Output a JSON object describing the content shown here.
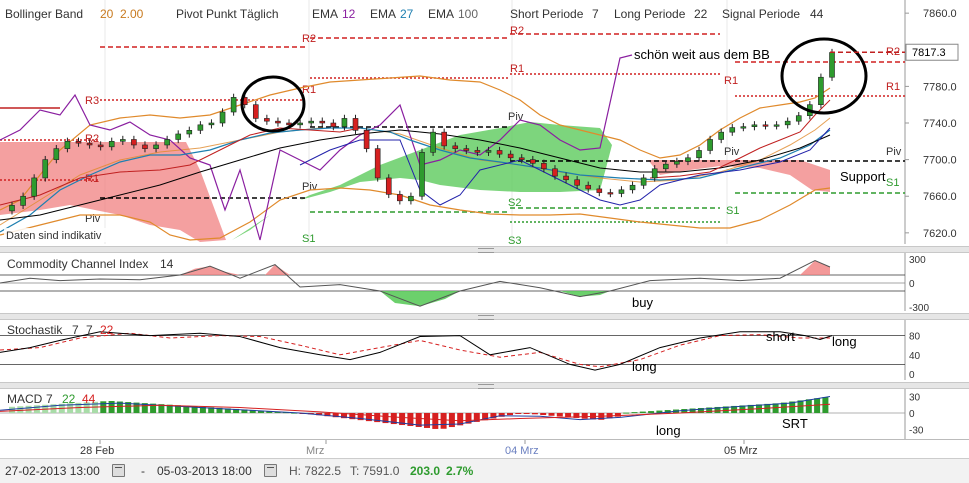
{
  "header": {
    "bollinger": {
      "label": "Bollinger Band",
      "p1": "20",
      "p2": "2.00"
    },
    "pivot": "Pivot Punkt Täglich",
    "ema1": {
      "label": "EMA",
      "value": "12"
    },
    "ema2": {
      "label": "EMA",
      "value": "27"
    },
    "ema3": {
      "label": "EMA",
      "value": "100"
    },
    "short": {
      "label": "Short Periode",
      "value": "7"
    },
    "long": {
      "label": "Long Periode",
      "value": "22"
    },
    "signal": {
      "label": "Signal Periode",
      "value": "44"
    }
  },
  "price_pane": {
    "axis_ticks": [
      "7860.0",
      "7820.0",
      "7780.0",
      "7740.0",
      "7700.0",
      "7660.0",
      "7620.0"
    ],
    "last_price": "7817.3",
    "disclaimer": "Daten sind indikativ",
    "annotations": {
      "bb_note": "schön weit aus dem BB",
      "support": "Support"
    },
    "pivot_labels": [
      "R2",
      "R1",
      "Piv",
      "S1",
      "S2",
      "S3"
    ]
  },
  "cci_pane": {
    "label": "Commodity Channel Index",
    "value": "14",
    "ticks": [
      "300",
      "0",
      "-300"
    ],
    "note": "buy"
  },
  "stoch_pane": {
    "label": "Stochastik",
    "p1": "7",
    "p2": "7",
    "p3": "22",
    "ticks": [
      "80",
      "40",
      "0"
    ],
    "notes": {
      "long1": "long",
      "short": "short",
      "long2": "long"
    }
  },
  "macd_pane": {
    "label": "MACD",
    "p1": "7",
    "p2": "22",
    "p3": "44",
    "ticks": [
      "30",
      "0",
      "-30"
    ],
    "notes": {
      "long": "long",
      "srt": "SRT"
    }
  },
  "x_axis": {
    "labels": [
      "28 Feb",
      "Mrz",
      "04 Mrz",
      "05 Mrz"
    ]
  },
  "footer": {
    "start": "27-02-2013 13:00",
    "dash": "-",
    "end": "05-03-2013 18:00",
    "high": "H: 7822.5",
    "low": "T: 7591.0",
    "change": "203.0",
    "pct": "2.7%"
  },
  "colors": {
    "up": "#2e9b2e",
    "down": "#d62020",
    "cloud_green": "#5ccb5c",
    "cloud_red": "#f08080",
    "bb_band": "#e08a2c",
    "ema_purple": "#8a1fa0"
  },
  "chart_data": [
    {
      "type": "candlestick",
      "title": "",
      "ylim": [
        7610,
        7870
      ],
      "ohlc_close_approx": [
        7650,
        7660,
        7680,
        7700,
        7712,
        7720,
        7718,
        7716,
        7714,
        7720,
        7722,
        7716,
        7712,
        7716,
        7722,
        7728,
        7732,
        7738,
        7740,
        7752,
        7768,
        7760,
        7745,
        7742,
        7740,
        7738,
        7740,
        7742,
        7740,
        7736,
        7745,
        7732,
        7712,
        7680,
        7662,
        7655,
        7660,
        7708,
        7730,
        7715,
        7712,
        7710,
        7708,
        7710,
        7706,
        7702,
        7700,
        7696,
        7690,
        7682,
        7678,
        7672,
        7668,
        7664,
        7663,
        7667,
        7672,
        7680,
        7690,
        7695,
        7698,
        7702,
        7710,
        7722,
        7730,
        7735,
        7736,
        7738,
        7737,
        7738,
        7742,
        7748,
        7760,
        7790,
        7817
      ],
      "pivot_levels": {
        "R2": 7848,
        "R1": 7785,
        "Piv": 7705,
        "S1": 7670,
        "S2": 7660,
        "S3": 7628
      }
    },
    {
      "type": "line",
      "name": "CCI",
      "ylim": [
        -300,
        300
      ],
      "ticks": [
        300,
        0,
        -300
      ]
    },
    {
      "type": "line",
      "name": "Stochastik",
      "ylim": [
        0,
        100
      ],
      "ticks": [
        80,
        40,
        0
      ]
    },
    {
      "type": "bar",
      "name": "MACD",
      "ylim": [
        -40,
        40
      ],
      "ticks": [
        30,
        0,
        -30
      ]
    }
  ]
}
